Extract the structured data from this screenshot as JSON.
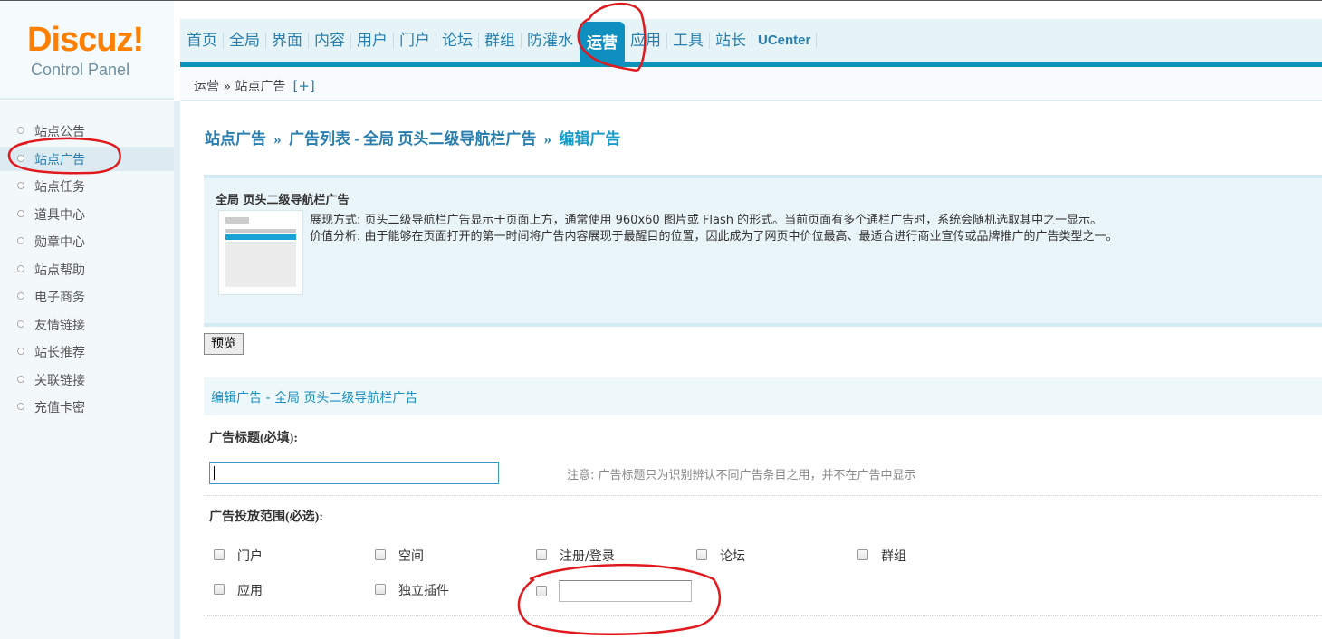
{
  "logo": {
    "brand": "Discuz!",
    "subtitle": "Control Panel"
  },
  "nav": {
    "items": [
      "首页",
      "全局",
      "界面",
      "内容",
      "用户",
      "门户",
      "论坛",
      "群组",
      "防灌水",
      "运营",
      "应用",
      "工具",
      "站长",
      "UCenter"
    ],
    "active": "运营"
  },
  "breadcrumb": {
    "path": "运营 » 站点广告",
    "expand": "[+]"
  },
  "sidebar": {
    "items": [
      "站点公告",
      "站点广告",
      "站点任务",
      "道具中心",
      "勋章中心",
      "站点帮助",
      "电子商务",
      "友情链接",
      "站长推荐",
      "关联链接",
      "充值卡密"
    ],
    "active": "站点广告"
  },
  "page": {
    "title_part1": "站点广告",
    "title_part2": "广告列表 - 全局 页头二级导航栏广告",
    "title_part3": "编辑广告",
    "separator": "»"
  },
  "info": {
    "heading": "全局 页头二级导航栏广告",
    "line1": "展现方式: 页头二级导航栏广告显示于页面上方，通常使用 960x60 图片或 Flash 的形式。当前页面有多个通栏广告时，系统会随机选取其中之一显示。",
    "line2": "价值分析: 由于能够在页面打开的第一时间将广告内容展现于最醒目的位置，因此成为了网页中价位最高、最适合进行商业宣传或品牌推广的广告类型之一。"
  },
  "preview_button": "预览",
  "form": {
    "section_title": "编辑广告 - 全局 页头二级导航栏广告",
    "ad_title_label": "广告标题(必填):",
    "ad_title_value": "",
    "ad_title_note": "注意: 广告标题只为识别辨认不同广告条目之用，并不在广告中显示",
    "scope_label": "广告投放范围(必选):",
    "scope_options": [
      "门户",
      "空间",
      "注册/登录",
      "论坛",
      "群组",
      "应用",
      "独立插件"
    ],
    "scope_custom_value": ""
  },
  "colors": {
    "accent": "#0e8fc0",
    "link": "#2a7fae",
    "logo": "#ff7f00",
    "annotation": "#e0191e"
  }
}
